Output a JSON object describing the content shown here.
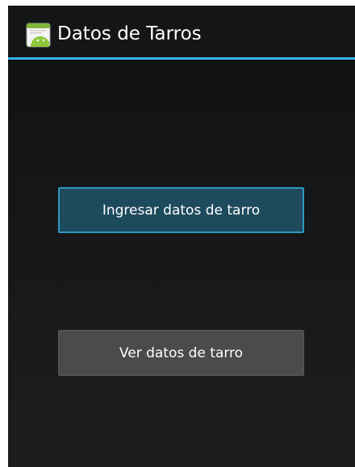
{
  "action_bar": {
    "title": "Datos de Tarros",
    "icon": "android-app-icon",
    "divider_color": "#33b5e5"
  },
  "buttons": {
    "enter_data_label": "Ingresar datos de tarro",
    "view_data_label": "Ver datos de tarro"
  },
  "colors": {
    "accent": "#33b5e5",
    "primary_button": "#1e4a5d",
    "secondary_button": "#4a4b4d",
    "background": "#141516"
  }
}
